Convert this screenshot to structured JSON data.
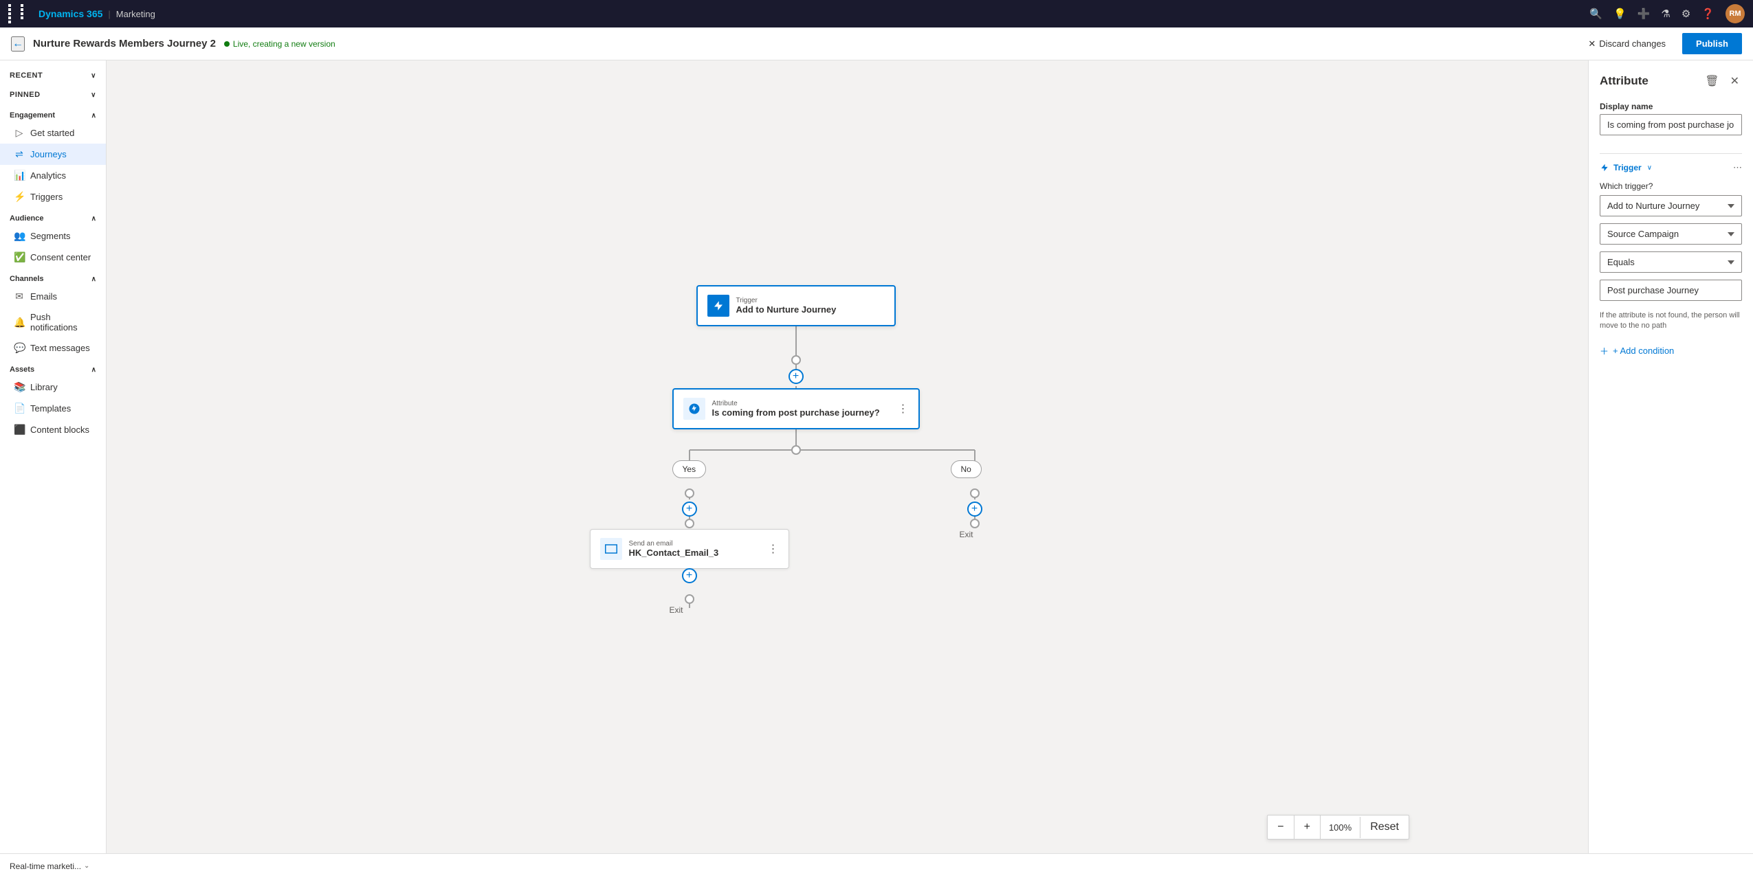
{
  "app": {
    "brand": "Dynamics 365",
    "module": "Marketing"
  },
  "topbar": {
    "icons": [
      "search",
      "lightbulb",
      "plus",
      "filter",
      "settings",
      "help"
    ],
    "avatar": "RM"
  },
  "header": {
    "journey_title": "Nurture Rewards Members Journey 2",
    "status": "Live, creating a new version",
    "discard_label": "Discard changes",
    "publish_label": "Publish"
  },
  "sidebar": {
    "recent_label": "Recent",
    "pinned_label": "Pinned",
    "sections": [
      {
        "name": "Engagement",
        "items": [
          {
            "id": "get-started",
            "label": "Get started",
            "icon": "▷"
          },
          {
            "id": "journeys",
            "label": "Journeys",
            "icon": "⇌",
            "active": true
          },
          {
            "id": "analytics",
            "label": "Analytics",
            "icon": "📊"
          },
          {
            "id": "triggers",
            "label": "Triggers",
            "icon": "⚡"
          }
        ]
      },
      {
        "name": "Audience",
        "items": [
          {
            "id": "segments",
            "label": "Segments",
            "icon": "👥"
          },
          {
            "id": "consent-center",
            "label": "Consent center",
            "icon": "✅"
          }
        ]
      },
      {
        "name": "Channels",
        "items": [
          {
            "id": "emails",
            "label": "Emails",
            "icon": "✉"
          },
          {
            "id": "push-notifications",
            "label": "Push notifications",
            "icon": "🔔"
          },
          {
            "id": "text-messages",
            "label": "Text messages",
            "icon": "💬"
          }
        ]
      },
      {
        "name": "Assets",
        "items": [
          {
            "id": "library",
            "label": "Library",
            "icon": "📚"
          },
          {
            "id": "templates",
            "label": "Templates",
            "icon": "📄"
          },
          {
            "id": "content-blocks",
            "label": "Content blocks",
            "icon": "⬛"
          }
        ]
      }
    ]
  },
  "canvas": {
    "nodes": {
      "trigger": {
        "label_small": "Trigger",
        "label": "Add to Nurture Journey"
      },
      "attribute": {
        "label_small": "Attribute",
        "label": "Is coming from post purchase journey?"
      },
      "email": {
        "label_small": "Send an email",
        "label": "HK_Contact_Email_3"
      }
    },
    "branches": {
      "yes": "Yes",
      "no": "No"
    },
    "exits": {
      "yes_exit": "Exit",
      "no_exit": "Exit"
    }
  },
  "right_panel": {
    "title": "Attribute",
    "display_name_label": "Display name",
    "display_name_value": "Is coming from post purchase journey?",
    "trigger_section_label": "Trigger",
    "which_trigger_label": "Which trigger?",
    "trigger_dropdown": "Add to Nurture Journey",
    "source_campaign_dropdown": "Source Campaign",
    "equals_dropdown": "Equals",
    "post_purchase_value": "Post purchase Journey",
    "not_found_text": "If the attribute is not found, the person will move to the no path",
    "add_condition_label": "+ Add condition"
  },
  "zoom": {
    "minus_label": "−",
    "plus_label": "+",
    "percent": "100%",
    "reset_label": "Reset"
  },
  "bottom_bar": {
    "label": "Real-time marketi...",
    "chevron": "⌄"
  }
}
